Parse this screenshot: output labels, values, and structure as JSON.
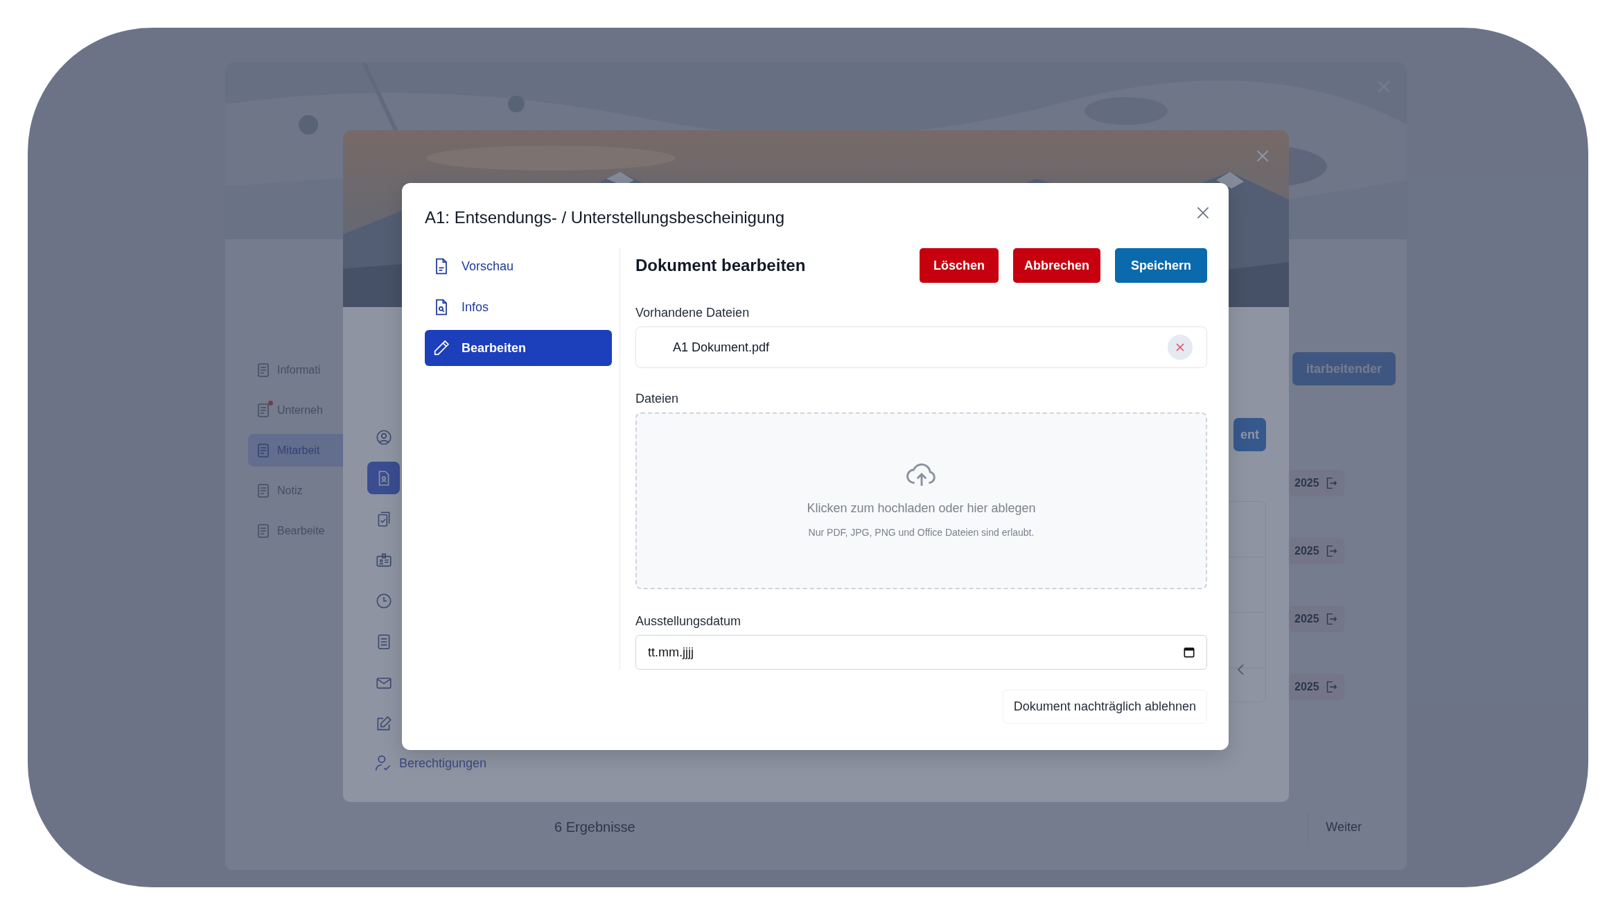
{
  "background_panel": {
    "nav_items": [
      {
        "label": "Informati",
        "selected": false,
        "notification": false
      },
      {
        "label": "Unterneh",
        "selected": false,
        "notification": true
      },
      {
        "label": "Mitarbeit",
        "selected": true,
        "notification": false
      },
      {
        "label": "Notiz",
        "selected": false,
        "notification": false
      },
      {
        "label": "Bearbeite",
        "selected": false,
        "notification": false
      }
    ],
    "add_button": "itarbeitender",
    "dates": [
      "2025",
      "2025",
      "2025",
      "2025"
    ],
    "results": "6 Ergebnisse",
    "next_button": "Weiter"
  },
  "background_modal": {
    "icon_tabs": [
      {
        "selected": false
      },
      {
        "selected": true
      },
      {
        "selected": false
      },
      {
        "selected": false
      },
      {
        "selected": false
      },
      {
        "selected": false
      },
      {
        "selected": false
      },
      {
        "selected": false
      }
    ],
    "permissions_label": "Berechtigungen",
    "action_button": "ent"
  },
  "dialog": {
    "title": "A1: Entsendungs- / Unterstellungsbescheinigung",
    "tabs": [
      {
        "label": "Vorschau",
        "selected": false
      },
      {
        "label": "Infos",
        "selected": false
      },
      {
        "label": "Bearbeiten",
        "selected": true
      }
    ],
    "heading": "Dokument bearbeiten",
    "buttons": [
      {
        "label": "Löschen",
        "kind": "danger"
      },
      {
        "label": "Abbrechen",
        "kind": "danger"
      },
      {
        "label": "Speichern",
        "kind": "primary"
      }
    ],
    "existing_files_label": "Vorhandene Dateien",
    "existing_files": [
      {
        "name": "A1 Dokument.pdf"
      }
    ],
    "files_label": "Dateien",
    "dropzone": {
      "text": "Klicken zum hochladen oder hier ablegen",
      "hint": "Nur PDF, JPG, PNG und Office Dateien sind erlaubt."
    },
    "date_label": "Ausstellungsdatum",
    "date_input": {
      "placeholder": "tt.mm.jjjj"
    },
    "reject_button": "Dokument nachträglich ablehnen"
  }
}
